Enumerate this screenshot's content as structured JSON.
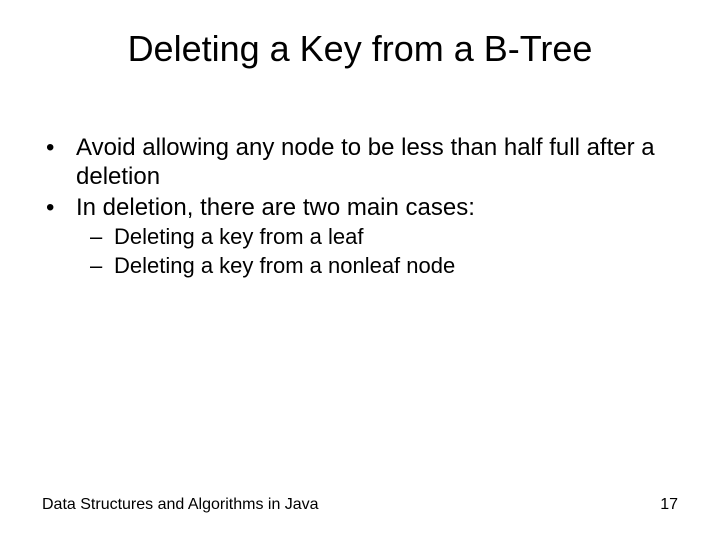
{
  "title": "Deleting a Key from a B-Tree",
  "bullets": {
    "b0": "Avoid allowing any node to be less than half full after a deletion",
    "b1": "In deletion, there are two main cases:",
    "s0": "Deleting a key from a leaf",
    "s1": "Deleting a key from a nonleaf node"
  },
  "footer": {
    "left": "Data Structures and Algorithms in Java",
    "page": "17"
  }
}
